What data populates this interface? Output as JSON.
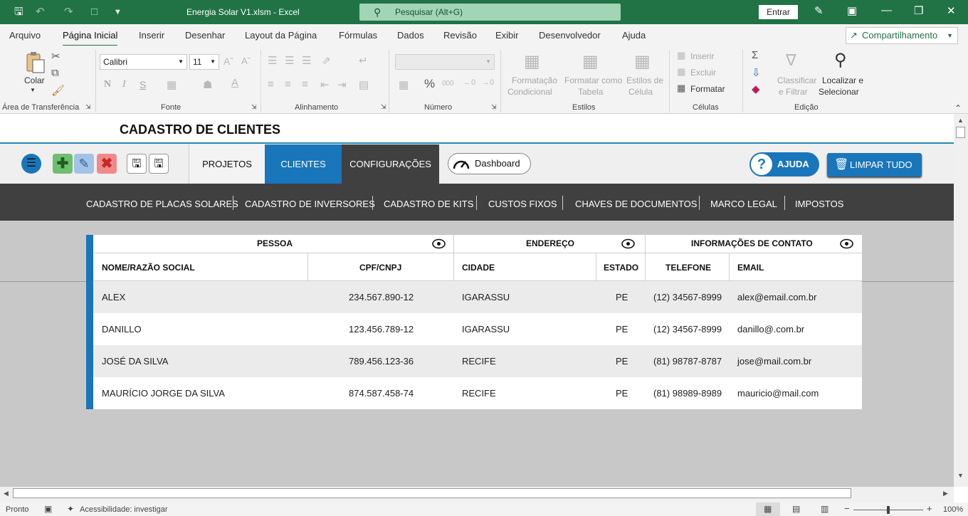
{
  "titlebar": {
    "doc_title": "Energia Solar V1.xlsm  -  Excel",
    "search_placeholder": "Pesquisar (Alt+G)",
    "signin": "Entrar"
  },
  "ribbon_tabs": [
    "Arquivo",
    "Página Inicial",
    "Inserir",
    "Desenhar",
    "Layout da Página",
    "Fórmulas",
    "Dados",
    "Revisão",
    "Exibir",
    "Desenvolvedor",
    "Ajuda"
  ],
  "share_label": "Compartilhamento",
  "ribbon": {
    "paste": "Colar",
    "font_name": "Calibri",
    "font_size": "11",
    "bold": "N",
    "italic": "I",
    "underline": "S",
    "formatacao": [
      "Formatação",
      "Condicional"
    ],
    "formatar_tabela": [
      "Formatar como",
      "Tabela"
    ],
    "estilos_celula": [
      "Estilos de",
      "Célula"
    ],
    "inserir": "Inserir",
    "excluir": "Excluir",
    "formatar": "Formatar",
    "classificar": [
      "Classificar",
      "e Filtrar"
    ],
    "localizar": [
      "Localizar e",
      "Selecionar"
    ],
    "groups": [
      "Área de Transferência",
      "Fonte",
      "Alinhamento",
      "Número",
      "Estilos",
      "Células",
      "Edição"
    ]
  },
  "sheet": {
    "title": "CADASTRO DE CLIENTES",
    "nav_tabs": [
      "PROJETOS",
      "CLIENTES",
      "CONFIGURAÇÕES"
    ],
    "dashboard": "Dashboard",
    "ajuda": "AJUDA",
    "limpar": "LIMPAR TUDO",
    "submenu": [
      "CADASTRO DE PLACAS SOLARES",
      "CADASTRO DE INVERSORES",
      "CADASTRO DE KITS",
      "CUSTOS FIXOS",
      "CHAVES DE DOCUMENTOS",
      "MARCO LEGAL",
      "IMPOSTOS"
    ],
    "groups": [
      "PESSOA",
      "ENDEREÇO",
      "INFORMAÇÕES DE CONTATO"
    ],
    "columns": [
      "NOME/RAZÃO SOCIAL",
      "CPF/CNPJ",
      "CIDADE",
      "ESTADO",
      "TELEFONE",
      "EMAIL"
    ],
    "rows": [
      [
        "ALEX",
        "234.567.890-12",
        "IGARASSU",
        "PE",
        "(12) 34567-8999",
        "alex@email.com.br"
      ],
      [
        "DANILLO",
        "123.456.789-12",
        "IGARASSU",
        "PE",
        "(12) 34567-8999",
        "danillo@.com.br"
      ],
      [
        "JOSÉ DA SILVA",
        "789.456.123-36",
        "RECIFE",
        "PE",
        "(81) 98787-8787",
        "jose@mail.com.br"
      ],
      [
        "MAURÍCIO JORGE DA SILVA",
        "874.587.458-74",
        "RECIFE",
        "PE",
        "(81) 98989-8989",
        "mauricio@mail.com"
      ]
    ]
  },
  "status": {
    "ready": "Pronto",
    "accessibility": "Acessibilidade: investigar",
    "zoom": "100%"
  },
  "colors": {
    "excel_green": "#217346",
    "accent_blue": "#1976ba",
    "dark_bar": "#404040"
  }
}
